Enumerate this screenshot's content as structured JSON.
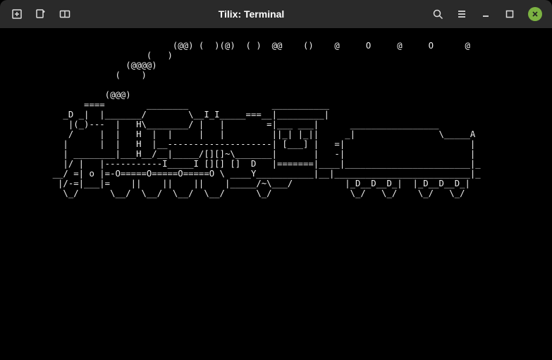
{
  "titlebar": {
    "title": "Tilix: Terminal"
  },
  "icons": {
    "add_tab": "add-tab-icon",
    "new_session": "new-session-icon",
    "split": "split-icon",
    "search": "search-icon",
    "menu": "menu-icon",
    "minimize": "minimize-icon",
    "maximize": "maximize-icon",
    "close": "close-icon"
  },
  "ascii": "                                (@@) (  )(@)  ( )  @@    ()    @     O     @     O      @\n                           (   )\n                       (@@@@)\n                     (    )\n\n                   (@@@)\n               ====        ________                ___________\n           _D _|  |_______/        \\__I_I_____===__|_________|\n            |(_)---  |   H\\________/ |   |        =|___ ___|      _________________\n            /     |  |   H  |  |     |   |         ||_| |_||     _|                \\_____A\n           |      |  |   H  |__--------------------| [___] |   =|                        |\n           | ________|___H__/__|_____/[][]~\\_______|       |   -|                        |\n           |/ |   |-----------I_____I [][] []  D   |=======|____|________________________|_\n         __/ =| o |=-O=====O=====O=====O \\ ____Y___________|__|__________________________|_\n          |/-=|___|=    ||    ||    ||    |_____/~\\___/          |_D__D__D_|  |_D__D__D_|\n           \\_/      \\__/  \\__/  \\__/  \\__/      \\_/               \\_/   \\_/    \\_/   \\_/"
}
